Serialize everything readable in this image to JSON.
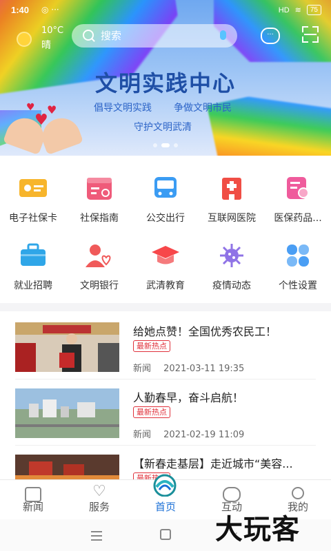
{
  "status_bar": {
    "time": "1:40",
    "extra": "◎ ···",
    "signal": "HD",
    "battery": "75"
  },
  "weather": {
    "temperature": "10°C",
    "condition": "晴"
  },
  "search": {
    "placeholder": "搜索"
  },
  "banner": {
    "title": "文明实践中心",
    "slogans": [
      "倡导文明实践",
      "争做文明市民",
      "守护文明武清"
    ],
    "page_count": 3,
    "active_page": 1
  },
  "services": [
    {
      "label": "电子社保卡",
      "icon": "id-card-icon",
      "color": "#f5a623"
    },
    {
      "label": "社保指南",
      "icon": "calendar-guide-icon",
      "color": "#ef5b7a"
    },
    {
      "label": "公交出行",
      "icon": "bus-icon",
      "color": "#3b9cf3"
    },
    {
      "label": "互联网医院",
      "icon": "hospital-icon",
      "color": "#f04e45"
    },
    {
      "label": "医保药品...",
      "icon": "medicine-search-icon",
      "color": "#ef5b9c"
    },
    {
      "label": "就业招聘",
      "icon": "briefcase-icon",
      "color": "#2fa6e8"
    },
    {
      "label": "文明银行",
      "icon": "user-heart-icon",
      "color": "#f05a5a"
    },
    {
      "label": "武清教育",
      "icon": "graduation-cap-icon",
      "color": "#f7474a"
    },
    {
      "label": "疫情动态",
      "icon": "virus-icon",
      "color": "#8f73e6"
    },
    {
      "label": "个性设置",
      "icon": "clover-settings-icon",
      "color": "#4a9ef4"
    }
  ],
  "news": [
    {
      "title": "给她点赞！全国优秀农民工！",
      "tag": "最新热点",
      "source": "新闻",
      "date": "2021-03-11 19:35"
    },
    {
      "title": "人勤春早，奋斗启航！",
      "tag": "最新热点",
      "source": "新闻",
      "date": "2021-02-19 11:09"
    },
    {
      "title": "【新春走基层】走近城市“美容...",
      "tag": "最新热点",
      "source": "",
      "date": ""
    }
  ],
  "tabs": [
    {
      "label": "新闻",
      "icon": "news-icon"
    },
    {
      "label": "服务",
      "icon": "heart-icon"
    },
    {
      "label": "首页",
      "icon": "home-logo-icon",
      "active": true
    },
    {
      "label": "互动",
      "icon": "chat-icon"
    },
    {
      "label": "我的",
      "icon": "profile-icon"
    }
  ],
  "watermark": "大玩客",
  "colors": {
    "accent": "#1a6fd6",
    "tag_red": "#e0303a",
    "banner_title": "#1f4fa6"
  }
}
